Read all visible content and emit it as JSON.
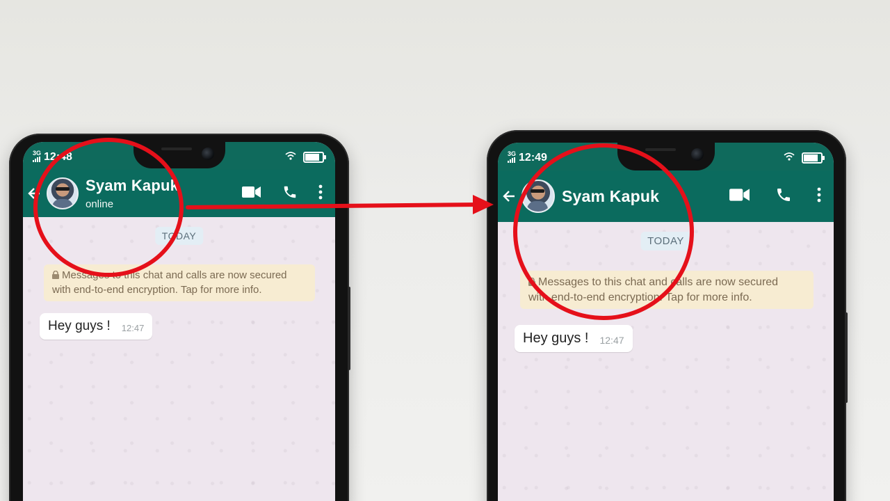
{
  "phones": [
    {
      "id": "left",
      "status_time": "12:48",
      "network": "3G",
      "contact_name": "Syam Kapuk",
      "contact_status": "online",
      "date_label": "TODAY",
      "encryption_notice_line1": "Messages to this chat and calls are now secured",
      "encryption_notice_line2": "with end-to-end encryption. Tap for more info.",
      "message_text": "Hey guys !",
      "message_time": "12:47"
    },
    {
      "id": "right",
      "status_time": "12:49",
      "network": "3G",
      "contact_name": "Syam Kapuk",
      "contact_status": "",
      "date_label": "TODAY",
      "encryption_notice_line1": "Messages to this chat and calls are now secured",
      "encryption_notice_line2": "with end-to-end encryption. Tap for more info.",
      "message_text": "Hey guys !",
      "message_time": "12:47"
    }
  ],
  "icons": [
    "back-arrow-icon",
    "video-call-icon",
    "voice-call-icon",
    "more-options-icon",
    "wifi-icon",
    "battery-icon",
    "signal-icon",
    "lock-icon"
  ],
  "colors": {
    "appbar": "#0b6b5e",
    "statusbar": "#0f6a5c",
    "annotation": "#e5101a",
    "chat_bg": "#eee6ee",
    "e2e_banner": "#f7ecd2"
  }
}
